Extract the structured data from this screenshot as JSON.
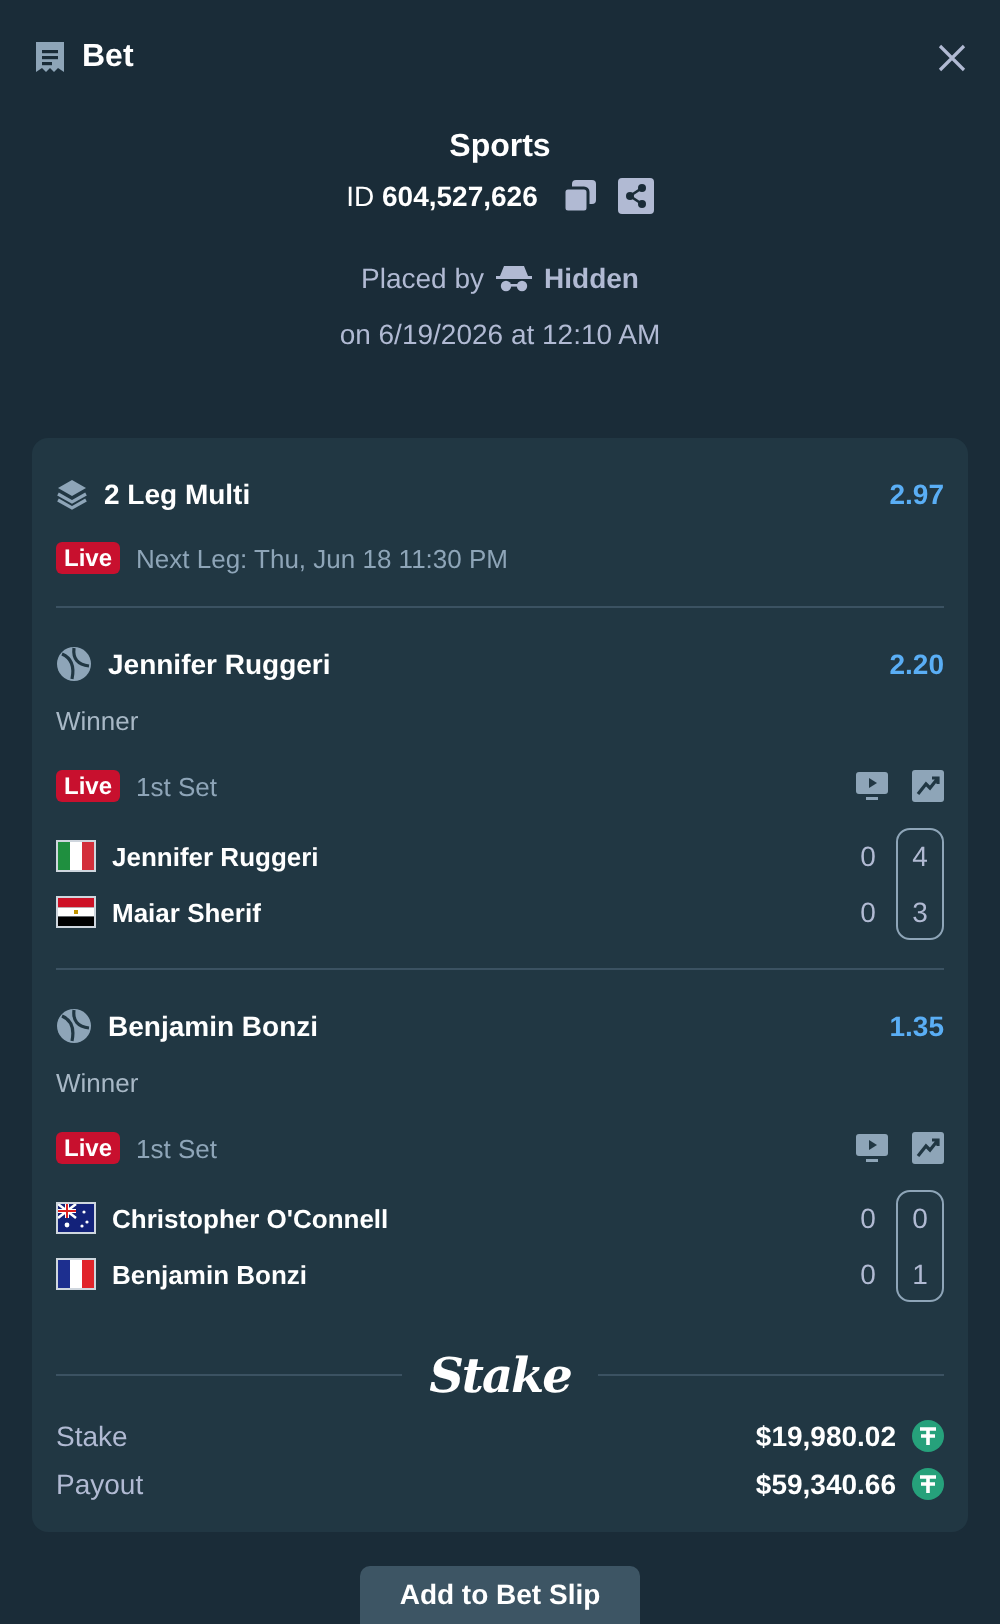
{
  "header": {
    "title": "Bet"
  },
  "summary": {
    "title": "Sports",
    "id_label": "ID",
    "id_value": "604,527,626",
    "placed_label": "Placed by",
    "placed_user": "Hidden",
    "placed_date": "on 6/19/2026 at 12:10 AM"
  },
  "multi": {
    "title": "2 Leg Multi",
    "odds": "2.97",
    "live_badge": "Live",
    "next_leg": "Next Leg: Thu, Jun 18 11:30 PM"
  },
  "legs": [
    {
      "selection": "Jennifer Ruggeri",
      "odds": "2.20",
      "market": "Winner",
      "live_badge": "Live",
      "period": "1st Set",
      "players": [
        {
          "kind": "it",
          "name": "Jennifer Ruggeri",
          "sets": "0",
          "games": "4"
        },
        {
          "kind": "eg",
          "name": "Maiar Sherif",
          "sets": "0",
          "games": "3"
        }
      ]
    },
    {
      "selection": "Benjamin Bonzi",
      "odds": "1.35",
      "market": "Winner",
      "live_badge": "Live",
      "period": "1st Set",
      "players": [
        {
          "kind": "au",
          "name": "Christopher O'Connell",
          "sets": "0",
          "games": "0"
        },
        {
          "kind": "fr",
          "name": "Benjamin Bonzi",
          "sets": "0",
          "games": "1"
        }
      ]
    }
  ],
  "brand": {
    "logo": "Stake"
  },
  "totals": [
    {
      "label": "Stake",
      "amount": "$19,980.02"
    },
    {
      "label": "Payout",
      "amount": "$59,340.66"
    }
  ],
  "footer": {
    "button": "Add to Bet Slip"
  }
}
